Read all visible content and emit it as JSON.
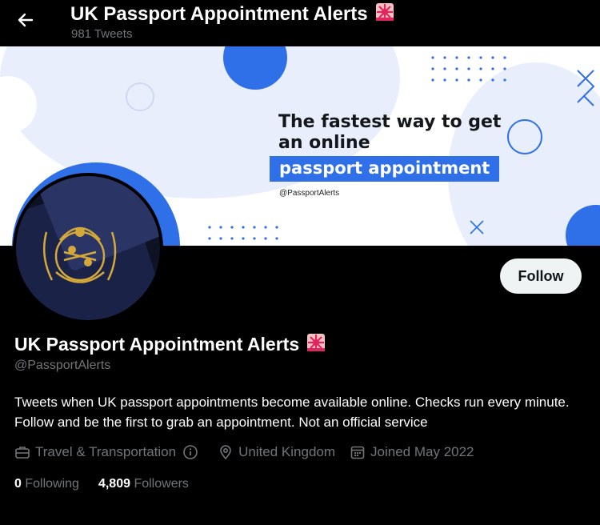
{
  "header": {
    "back_icon": "arrow-left-icon",
    "title": "UK Passport Appointment Alerts",
    "title_emoji": "siren-icon",
    "tweet_count": "981 Tweets"
  },
  "banner": {
    "headline_line1": "The fastest way to get",
    "headline_line2": "an online",
    "highlight": "passport appointment",
    "handle": "@PassportAlerts",
    "accent_color": "#2f6fe8"
  },
  "profile": {
    "follow_label": "Follow",
    "name": "UK Passport Appointment Alerts",
    "handle": "@PassportAlerts",
    "bio": "Tweets when UK passport appointments become available online. Checks run every minute. Follow and be the first to grab an appointment. Not an official service",
    "category": "Travel & Transportation",
    "location": "United Kingdom",
    "joined": "Joined May 2022",
    "following_count": "0",
    "following_label": "Following",
    "followers_count": "4,809",
    "followers_label": "Followers"
  }
}
